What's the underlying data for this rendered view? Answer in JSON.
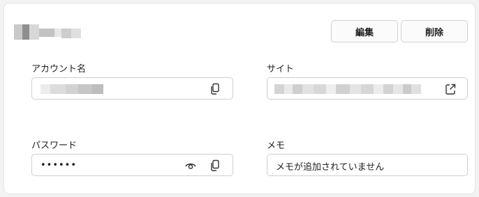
{
  "header": {
    "edit_label": "編集",
    "delete_label": "削除"
  },
  "fields": {
    "account": {
      "label": "アカウント名"
    },
    "site": {
      "label": "サイト"
    },
    "password": {
      "label": "パスワード",
      "masked_value": "••••••"
    },
    "memo": {
      "label": "メモ",
      "value": "メモが追加されていません"
    }
  },
  "icons": {
    "copy": "copy-icon",
    "external": "open-external-icon",
    "reveal": "eye-icon"
  },
  "colors": {
    "background": "#f3f3f3",
    "card": "#ffffff",
    "border": "#cfcfcf",
    "text": "#1f1f1f",
    "icon": "#333333"
  }
}
